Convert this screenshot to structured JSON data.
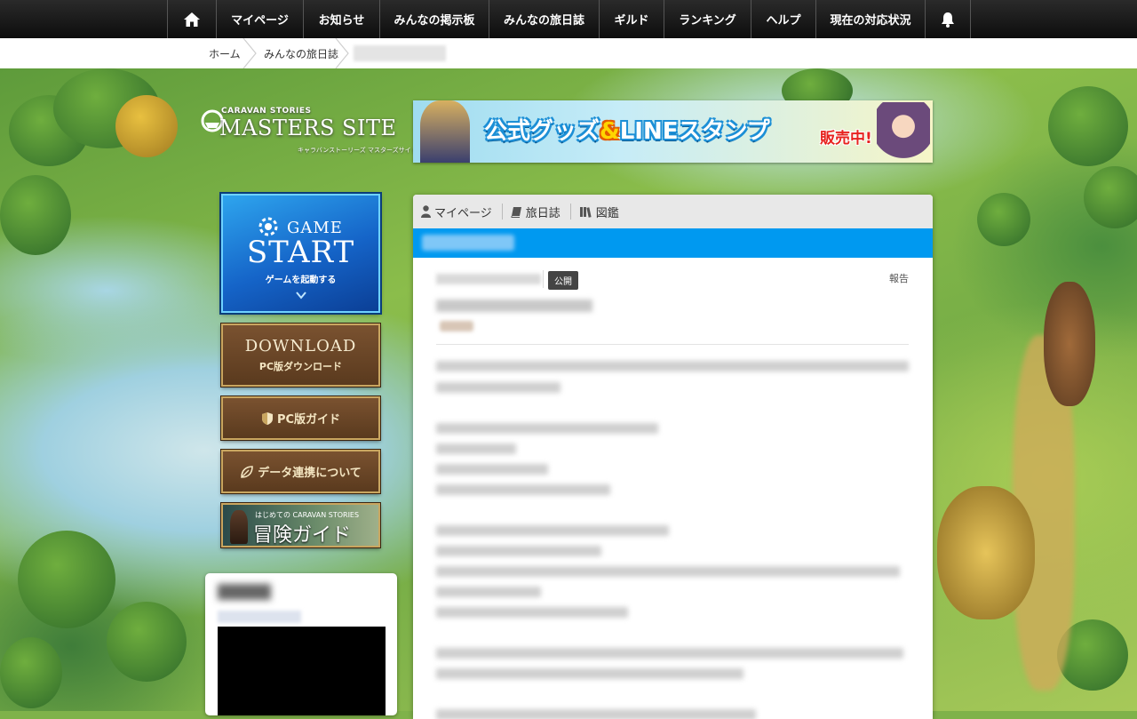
{
  "nav": {
    "items": [
      "マイページ",
      "お知らせ",
      "みんなの掲示板",
      "みんなの旅日誌",
      "ギルド",
      "ランキング",
      "ヘルプ",
      "現在の対応状況"
    ]
  },
  "breadcrumb": {
    "home": "ホーム",
    "section": "みんなの旅日誌"
  },
  "logo": {
    "small": "CARAVAN STORIES",
    "big": "MASTERS SITE",
    "kana": "キャラバンストーリーズ マスターズサイト"
  },
  "banner": {
    "part1": "公式グッズ",
    "amp": "&",
    "part2": "LINEスタンプ",
    "sale": "販売中!"
  },
  "sidebar": {
    "game_start": {
      "top": "GAME",
      "main": "START",
      "sub": "ゲームを起動する"
    },
    "download": {
      "main": "DOWNLOAD",
      "sub": "PC版ダウンロード"
    },
    "pc_guide": "PC版ガイド",
    "data_link": "データ連携について",
    "adventure_guide": {
      "small": "はじめての CARAVAN STORIES",
      "big": "冒険ガイド"
    }
  },
  "tabs": [
    "マイページ",
    "旅日誌",
    "図鑑"
  ],
  "entry": {
    "badge": "公開",
    "report": "報告"
  },
  "colors": {
    "nav_bg": "#111111",
    "accent_blue": "#0099f0",
    "badge_bg": "#444444"
  },
  "icons": {
    "home": "home-icon",
    "bell": "bell-icon",
    "user": "user-icon",
    "book": "book-icon",
    "books": "books-icon",
    "shield": "shield-icon",
    "leaf": "leaf-icon"
  }
}
